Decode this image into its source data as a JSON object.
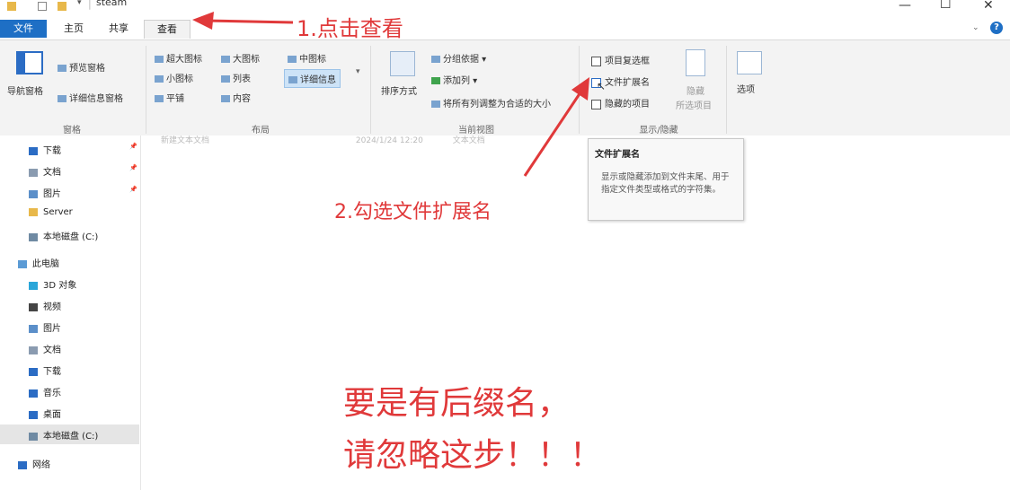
{
  "window": {
    "title": "steam"
  },
  "tabs": {
    "file": "文件",
    "home": "主页",
    "share": "共享",
    "view": "查看"
  },
  "ribbon": {
    "panes": {
      "nav_pane": "导航窗格",
      "preview_pane": "预览窗格",
      "details_pane": "详细信息窗格",
      "group_label": "窗格"
    },
    "layout": {
      "xl_icons": "超大图标",
      "large_icons": "大图标",
      "medium_icons": "中图标",
      "small_icons": "小图标",
      "list": "列表",
      "details": "详细信息",
      "tiles": "平铺",
      "content": "内容",
      "group_label": "布局"
    },
    "current_view": {
      "sort_by": "排序方式",
      "group_by": "分组依据",
      "add_columns": "添加列",
      "size_all_columns": "将所有列调整为合适的大小",
      "group_label": "当前视图"
    },
    "show_hide": {
      "item_checkboxes": "项目复选框",
      "file_extensions": "文件扩展名",
      "hidden_items": "隐藏的项目",
      "hide_selected": "隐藏",
      "hide_selected_line2": "所选项目",
      "group_label": "显示/隐藏"
    },
    "options": "选项"
  },
  "nav": {
    "quick": [
      {
        "label": "下载",
        "color": "#2b6cc4"
      },
      {
        "label": "文档",
        "color": "#8a9bb0"
      },
      {
        "label": "图片",
        "color": "#5b8fc9"
      },
      {
        "label": "Server",
        "color": "#e8b84a"
      },
      {
        "label": "本地磁盘 (C:)",
        "color": "#6f8aa3"
      }
    ],
    "this_pc": "此电脑",
    "pc_items": [
      {
        "label": "3D 对象",
        "color": "#2aa6d9"
      },
      {
        "label": "视频",
        "color": "#444444"
      },
      {
        "label": "图片",
        "color": "#5b8fc9"
      },
      {
        "label": "文档",
        "color": "#8a9bb0"
      },
      {
        "label": "下载",
        "color": "#2b6cc4"
      },
      {
        "label": "音乐",
        "color": "#2b6cc4"
      },
      {
        "label": "桌面",
        "color": "#2b6cc4"
      },
      {
        "label": "本地磁盘 (C:)",
        "color": "#6f8aa3"
      }
    ],
    "network": "网络"
  },
  "content": {
    "file_name": "新建文本文档",
    "file_date": "2024/1/24 12:20",
    "file_type": "文本文档"
  },
  "tooltip": {
    "title": "文件扩展名",
    "description": "显示或隐藏添加到文件末尾、用于指定文件类型或格式的字符集。"
  },
  "annotations": {
    "step1": "1.点击查看",
    "step2": "2.勾选文件扩展名",
    "note_line1": "要是有后缀名，",
    "note_line2": "请忽略这步！！！",
    "color": "#e0393a"
  }
}
